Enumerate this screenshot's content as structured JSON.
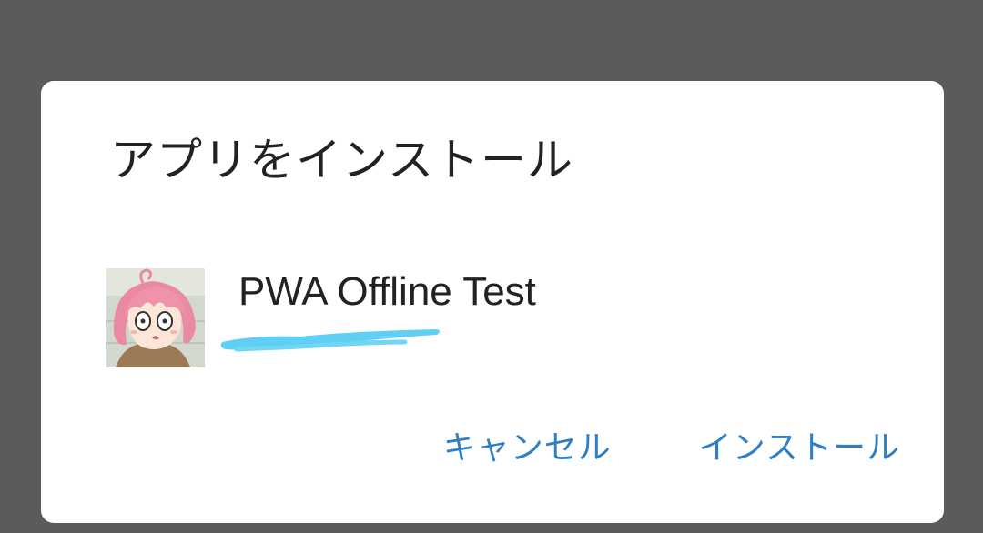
{
  "dialog": {
    "title": "アプリをインストール",
    "app": {
      "name": "PWA Offline Test",
      "icon": "anime-avatar-icon"
    },
    "actions": {
      "cancel_label": "キャンセル",
      "install_label": "インストール"
    }
  },
  "colors": {
    "scrim": "#5b5b5b",
    "dialog_bg": "#ffffff",
    "title_text": "#222222",
    "accent": "#2f7fc4",
    "redaction": "#5fd0f3"
  }
}
